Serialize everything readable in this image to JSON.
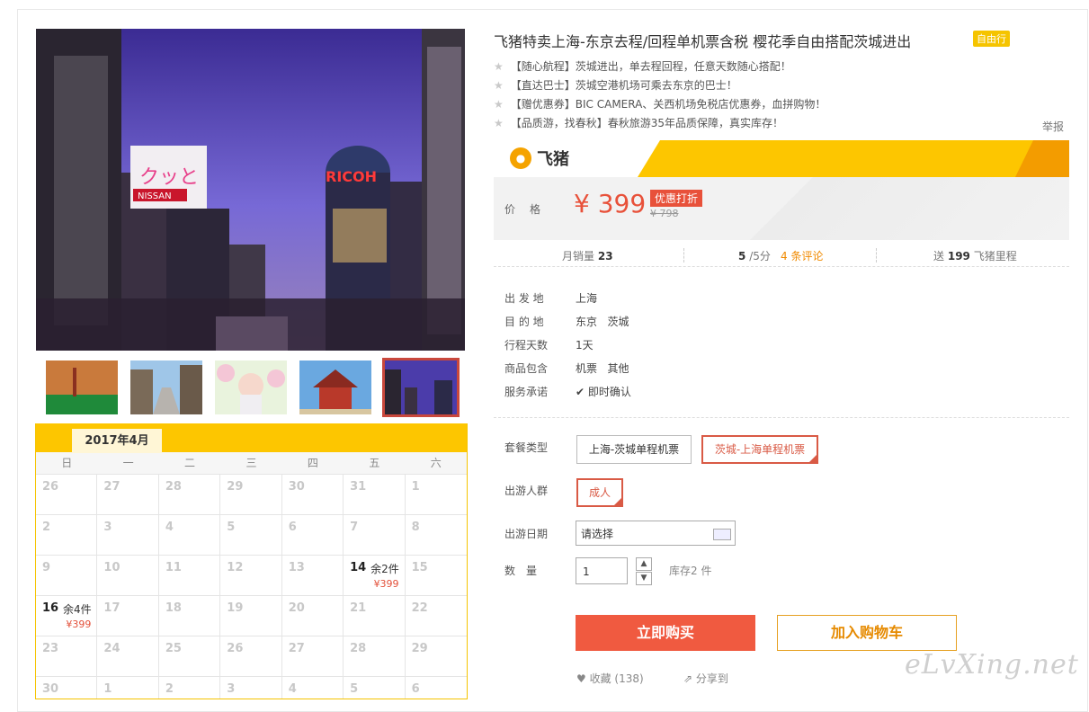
{
  "product": {
    "title": "飞猪特卖上海-东京去程/回程单机票含税 樱花季自由搭配茨城进出",
    "tag": "自由行",
    "features": [
      "【随心航程】茨城进出，单去程回程，任意天数随心搭配！",
      "【直达巴士】茨城空港机场可乘去东京的巴士！",
      "【赠优惠券】BIC CAMERA、关西机场免税店优惠券，血拼购物！",
      "【品质游，找春秋】春秋旅游35年品质保障，真实库存！"
    ],
    "report": "举报"
  },
  "brand": {
    "name": "飞猪",
    "icon": "pig-logo-icon"
  },
  "price": {
    "label": "价格",
    "current": "¥ 399",
    "badge": "优惠打折",
    "original": "¥ 798"
  },
  "stats": {
    "monthly_sales_label": "月销量",
    "monthly_sales": "23",
    "score": "5",
    "score_suffix": "/5分",
    "reviews": "4 条评论",
    "miles_prefix": "送",
    "miles": "199",
    "miles_suffix": "飞猪里程"
  },
  "info": [
    {
      "label": "出 发 地",
      "value": "上海"
    },
    {
      "label": "目 的 地",
      "value": "东京   茨城"
    },
    {
      "label": "行程天数",
      "value": "1天"
    },
    {
      "label": "商品包含",
      "value": "机票   其他"
    },
    {
      "label": "服务承诺",
      "value": "即时确认"
    }
  ],
  "options": {
    "package_label": "套餐类型",
    "package_a": "上海-茨城单程机票",
    "package_b": "茨城-上海单程机票",
    "crowd_label": "出游人群",
    "crowd": "成人",
    "date_label": "出游日期",
    "date_placeholder": "请选择",
    "qty_label": "数　量",
    "qty_value": "1",
    "stock": "库存2 件"
  },
  "actions": {
    "buy": "立即购买",
    "cart": "加入购物车",
    "favorite": "收藏 (138)",
    "share": "分享到"
  },
  "calendar": {
    "month": "2017年4月",
    "weekdays": [
      "日",
      "一",
      "二",
      "三",
      "四",
      "五",
      "六"
    ],
    "rows": [
      [
        "26",
        "27",
        "28",
        "29",
        "30",
        "31",
        "1"
      ],
      [
        "2",
        "3",
        "4",
        "5",
        "6",
        "7",
        "8"
      ],
      [
        "9",
        "10",
        "11",
        "12",
        "13",
        "14",
        "15"
      ],
      [
        "16",
        "17",
        "18",
        "19",
        "20",
        "21",
        "22"
      ],
      [
        "23",
        "24",
        "25",
        "26",
        "27",
        "28",
        "29"
      ],
      [
        "30",
        "1",
        "2",
        "3",
        "4",
        "5",
        "6"
      ]
    ],
    "available": {
      "14": {
        "stock": "余2件",
        "price": "¥399"
      },
      "16": {
        "stock": "余4件",
        "price": "¥399"
      }
    }
  },
  "watermark": "eLvXing.net"
}
